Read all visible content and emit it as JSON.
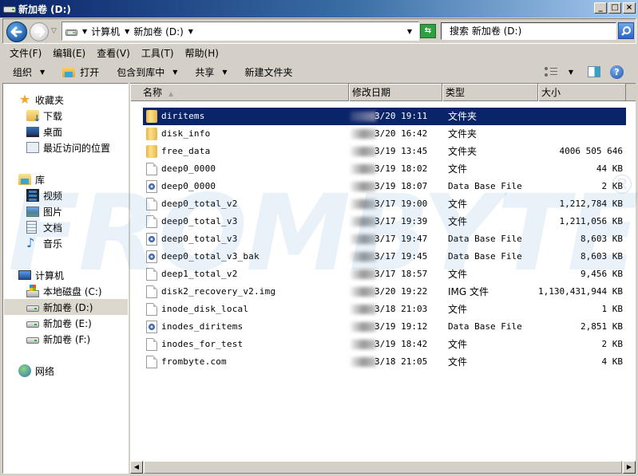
{
  "window": {
    "title": "新加卷 (D:)",
    "controls": {
      "minimize": "_",
      "maximize": "□",
      "close": "×"
    }
  },
  "address": {
    "crumbs": [
      "计算机",
      "新加卷 (D:)"
    ],
    "search_placeholder": "搜索 新加卷 (D:)"
  },
  "menubar": [
    "文件(F)",
    "编辑(E)",
    "查看(V)",
    "工具(T)",
    "帮助(H)"
  ],
  "toolbar": {
    "organize": "组织",
    "open": "打开",
    "include_library": "包含到库中",
    "share": "共享",
    "new_folder": "新建文件夹"
  },
  "navpane": {
    "favorites": {
      "label": "收藏夹",
      "items": [
        "下载",
        "桌面",
        "最近访问的位置"
      ]
    },
    "libraries": {
      "label": "库",
      "items": [
        "视频",
        "图片",
        "文档",
        "音乐"
      ]
    },
    "computer": {
      "label": "计算机",
      "items": [
        "本地磁盘 (C:)",
        "新加卷 (D:)",
        "新加卷 (E:)",
        "新加卷 (F:)"
      ],
      "selected": "新加卷 (D:)"
    },
    "network": {
      "label": "网络"
    }
  },
  "columns": {
    "name": "名称",
    "date": "修改日期",
    "type": "类型",
    "size": "大小"
  },
  "files": [
    {
      "name": "diritems",
      "icon": "folder",
      "date": "3/20 19:11",
      "type": "文件夹",
      "size": "",
      "selected": true
    },
    {
      "name": "disk_info",
      "icon": "folder",
      "date": "3/20 16:42",
      "type": "文件夹",
      "size": ""
    },
    {
      "name": "free_data",
      "icon": "folder",
      "date": "3/19 13:45",
      "type": "文件夹",
      "size": "4006 505 646"
    },
    {
      "name": "deep0_0000",
      "icon": "file",
      "date": "3/19 18:02",
      "type": "文件",
      "size": "44 KB"
    },
    {
      "name": "deep0_0000",
      "icon": "db",
      "date": "3/19 18:07",
      "type": "Data Base File",
      "size": "2 KB"
    },
    {
      "name": "deep0_total_v2",
      "icon": "file",
      "date": "3/17 19:00",
      "type": "文件",
      "size": "1,212,784 KB"
    },
    {
      "name": "deep0_total_v3",
      "icon": "file",
      "date": "3/17 19:39",
      "type": "文件",
      "size": "1,211,056 KB"
    },
    {
      "name": "deep0_total_v3",
      "icon": "db",
      "date": "3/17 19:47",
      "type": "Data Base File",
      "size": "8,603 KB"
    },
    {
      "name": "deep0_total_v3_bak",
      "icon": "db",
      "date": "3/17 19:45",
      "type": "Data Base File",
      "size": "8,603 KB"
    },
    {
      "name": "deep1_total_v2",
      "icon": "file",
      "date": "3/17 18:57",
      "type": "文件",
      "size": "9,456 KB"
    },
    {
      "name": "disk2_recovery_v2.img",
      "icon": "file",
      "date": "3/20 19:22",
      "type": "IMG 文件",
      "size": "1,130,431,944 KB"
    },
    {
      "name": "inode_disk_local",
      "icon": "file",
      "date": "3/18 21:03",
      "type": "文件",
      "size": "1 KB"
    },
    {
      "name": "inodes_diritems",
      "icon": "db",
      "date": "3/19 19:12",
      "type": "Data Base File",
      "size": "2,851 KB"
    },
    {
      "name": "inodes_for_test",
      "icon": "file",
      "date": "3/19 18:42",
      "type": "文件",
      "size": "2 KB"
    },
    {
      "name": "frombyte.com",
      "icon": "file",
      "date": "3/18 21:05",
      "type": "文件",
      "size": "4 KB"
    }
  ],
  "watermark": {
    "text": "FROMBYTE",
    "mark": "®"
  },
  "colors": {
    "selection": "#0a246a",
    "titlebar_start": "#0a246a",
    "titlebar_end": "#a6caf0"
  }
}
